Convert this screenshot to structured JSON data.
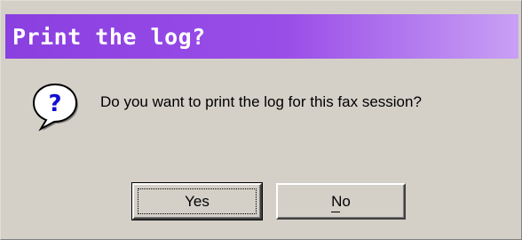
{
  "dialog": {
    "title": "Print the log?",
    "message": "Do you want to print the log for this fax session?",
    "icon": "question-icon",
    "title_gradient": [
      "#8a3fe0",
      "#c8a0f4"
    ]
  },
  "buttons": {
    "yes_label": "Yes",
    "no_label": "No",
    "default": "Yes"
  }
}
